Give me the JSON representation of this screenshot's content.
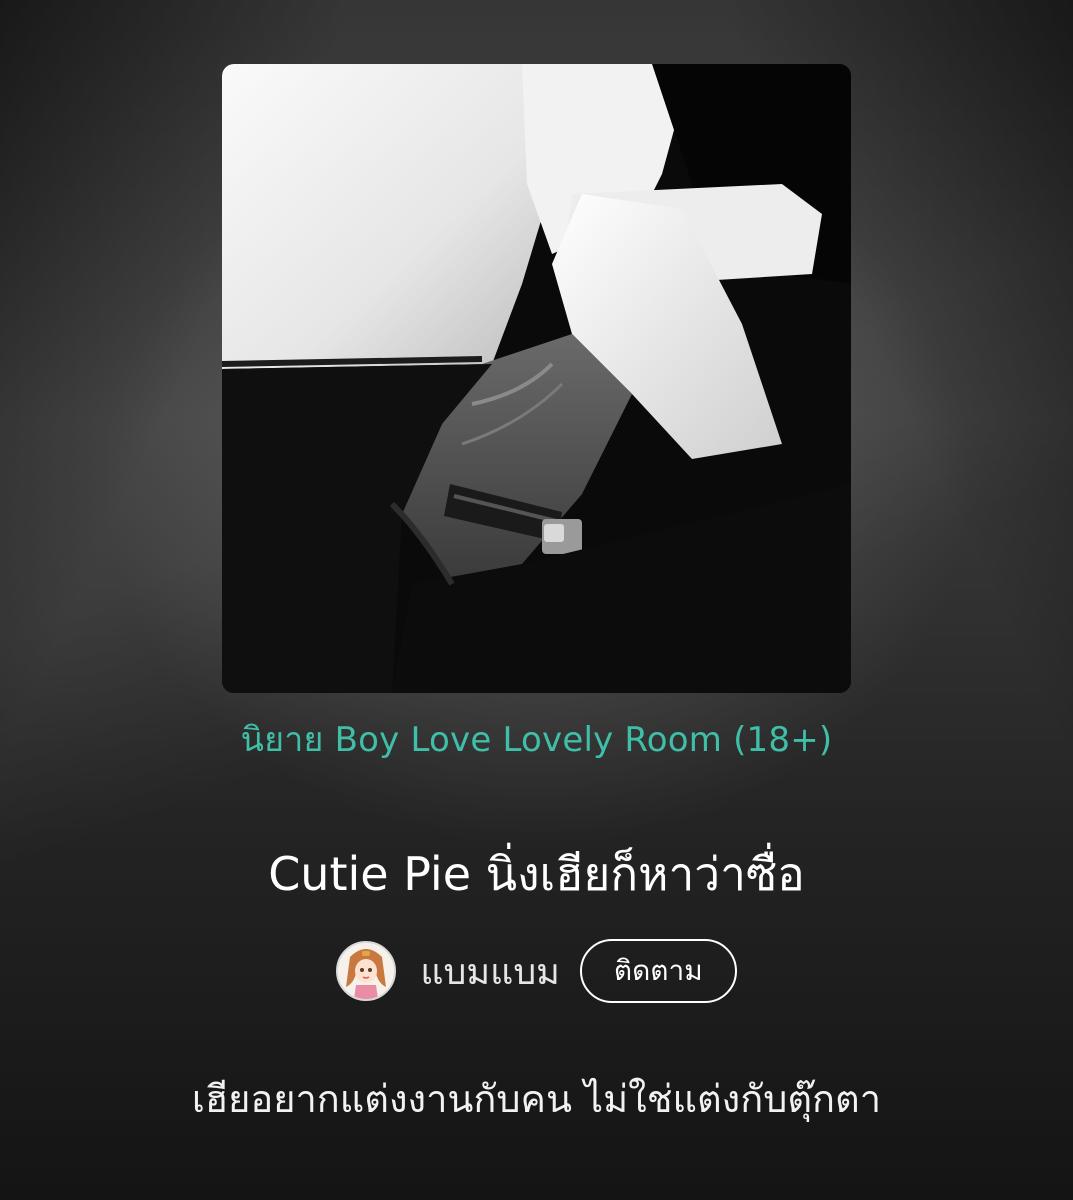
{
  "cover": {
    "icon": "cover-image"
  },
  "genre_label": "นิยาย Boy Love Lovely Room (18+)",
  "title": "Cutie Pie นิ่งเฮียก็หาว่าซื่อ",
  "author": {
    "name": "แบมแบม",
    "follow_label": "ติดตาม",
    "avatar_icon": "avatar"
  },
  "synopsis": "เฮียอยากแต่งงานกับคน ไม่ใช่แต่งกับตุ๊กตา",
  "colors": {
    "genre": "#3fbfa8",
    "title": "#ffffff",
    "background": "#2a2a2a"
  }
}
